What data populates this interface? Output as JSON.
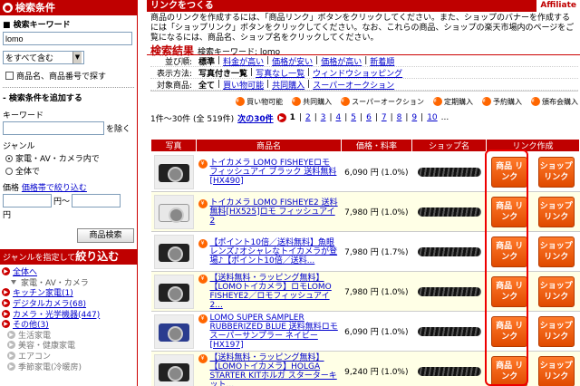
{
  "sidebar": {
    "title": "検索条件",
    "keyword_label": "検索キーワード",
    "keyword_value": "lomo",
    "match_select": "をすべて含む",
    "include_code_label": "商品名、商品番号で探す",
    "add_cond_label": "検索条件を追加する",
    "keyword2_label": "キーワード",
    "exclude_label": "を除く",
    "genre_label": "ジャンル",
    "genre_opt1": "家電・AV・カメラ内で",
    "genre_opt2": "全体で",
    "price_label": "価格",
    "price_link": "価格帯で絞り込む",
    "price_sep": "円〜",
    "price_unit": "円",
    "search_button": "商品検索",
    "genre_head_prefix": "ジャンルを指定して",
    "genre_head_big": "絞り込む",
    "genres": [
      {
        "label": "全体へ",
        "type": "link"
      },
      {
        "label": "家電・AV・カメラ",
        "type": "parent"
      },
      {
        "label": "キッチン家電(1)",
        "type": "link"
      },
      {
        "label": "デジタルカメラ(68)",
        "type": "link"
      },
      {
        "label": "カメラ・光学機器(447)",
        "type": "link"
      },
      {
        "label": "その他(3)",
        "type": "link"
      },
      {
        "label": "生活家電",
        "type": "gray"
      },
      {
        "label": "美容・健康家電",
        "type": "gray"
      },
      {
        "label": "エアコン",
        "type": "gray"
      },
      {
        "label": "季節家電(冷暖房)",
        "type": "gray"
      }
    ]
  },
  "main": {
    "title": "リンクをつくる",
    "affiliate": "Affiliate",
    "intro": "商品のリンクを作成するには、「商品リンク」ボタンをクリックしてください。また、ショップのバナーを作成するには「ショップリンク」ボタンをクリックしてください。なお、これらの商品、ショップの楽天市場内のページをご覧になるには、商品名、ショップ名をクリックしてください。",
    "result_title": "検索結果",
    "result_kw": "検索キーワード: lomo",
    "filters": [
      {
        "key": "並び順:",
        "opts": [
          "標準",
          "料金が高い",
          "価格が安い",
          "価格が高い",
          "新着順"
        ]
      },
      {
        "key": "表示方法:",
        "opts": [
          "写真付き一覧",
          "写真なし一覧",
          "ウィンドウショッピング"
        ]
      },
      {
        "key": "対象商品:",
        "opts": [
          "全て",
          "買い物可能",
          "共同購入",
          "スーパーオークション"
        ]
      }
    ],
    "legend": [
      "買い物可能",
      "共同購入",
      "スーパーオークション",
      "定期購入",
      "予約購入",
      "頒布会購入"
    ],
    "pager": {
      "count": "1件〜30件 (全 519件)",
      "next": "次の30件",
      "pages": [
        "1",
        "2",
        "3",
        "4",
        "5",
        "6",
        "7",
        "8",
        "9",
        "10"
      ],
      "more": "..."
    },
    "columns": [
      "写真",
      "商品名",
      "価格・料率",
      "ショップ名",
      "リンク作成"
    ],
    "product_btn": "商品\nリンク",
    "shop_btn": "ショップ\nリンク",
    "rows": [
      {
        "name": "トイカメラ LOMO FISHEYEロモ フィッシュアイ ブラック 送料無料[HX490]",
        "price": "6,090 円 (1.0%)",
        "cam": "dark"
      },
      {
        "name": "トイカメラ LOMO FISHEYE2 送料無料[HX525]ロモ フィッシュアイ2",
        "price": "7,980 円 (1.0%)",
        "cam": "white"
      },
      {
        "name": "【ポイント10倍／送料無料】魚眼レンズ♪オシャレなトイカメラが登場♪【ポイント10倍／送料...",
        "price": "7,980 円 (1.7%)",
        "cam": "dark"
      },
      {
        "name": "【送料無料・ラッピング無料】【LOMOトイカメラ】ロモLOMO FISHEYE2／ロモフィッシュアイ2...",
        "price": "7,980 円 (1.0%)",
        "cam": "dark"
      },
      {
        "name": "LOMO SUPER SAMPLER RUBBERIZED BLUE 送料無料ロモ スーパーサンプラー ネイビー[HX197]",
        "price": "6,090 円 (1.0%)",
        "cam": "blue"
      },
      {
        "name": "【送料無料・ラッピング無料】【LOMOトイカメラ】HOLGA STARTER KITホルガ スターターキット...",
        "price": "9,240 円 (1.0%)",
        "cam": "dark"
      }
    ]
  }
}
